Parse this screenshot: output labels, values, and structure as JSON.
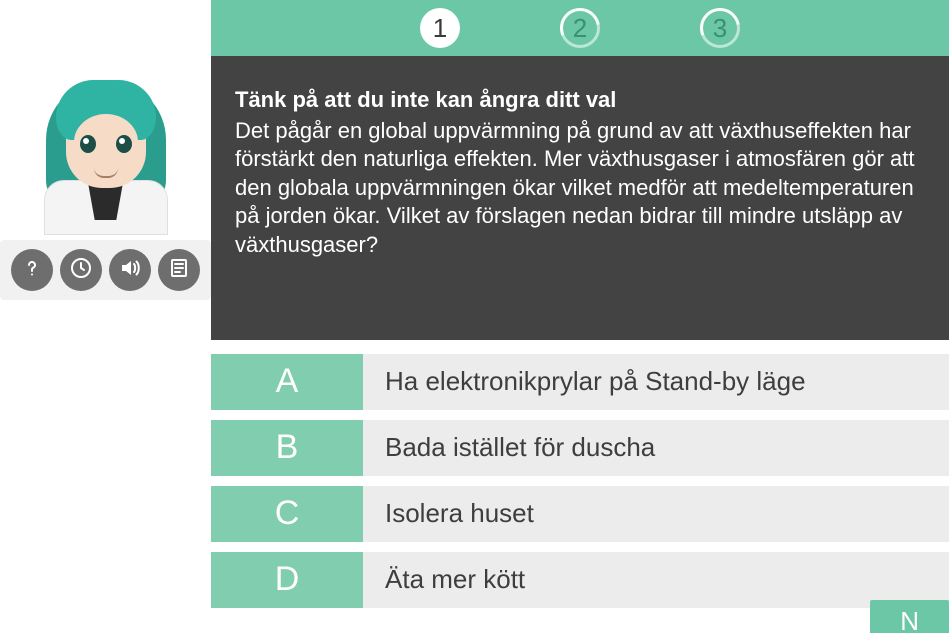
{
  "colors": {
    "accent": "#6bc7a6",
    "accent_soft": "#80cdb0",
    "panel_dark": "#434343",
    "answer_bg": "#ececec"
  },
  "avatar": {
    "name": "tutor-avatar"
  },
  "toolbar": {
    "items": [
      {
        "name": "help-icon"
      },
      {
        "name": "clock-icon"
      },
      {
        "name": "sound-icon"
      },
      {
        "name": "transcript-icon"
      }
    ]
  },
  "steps": [
    {
      "label": "1",
      "active": true
    },
    {
      "label": "2",
      "active": false
    },
    {
      "label": "3",
      "active": false
    }
  ],
  "question": {
    "warning": "Tänk på att du inte kan ångra ditt val",
    "body": "Det pågår en global uppvärmning på grund av att växthuseffekten har förstärkt den naturliga effekten. Mer växthusgaser i atmosfären gör att den globala uppvärmningen ökar vilket medför att medeltemperaturen på jorden ökar. Vilket av förslagen nedan bidrar till mindre utsläpp av växthusgaser?"
  },
  "answers": [
    {
      "letter": "A",
      "text": "Ha elektronikprylar på Stand-by läge"
    },
    {
      "letter": "B",
      "text": "Bada istället för duscha"
    },
    {
      "letter": "C",
      "text": "Isolera huset"
    },
    {
      "letter": "D",
      "text": "Äta mer kött"
    }
  ],
  "next_label": "N"
}
